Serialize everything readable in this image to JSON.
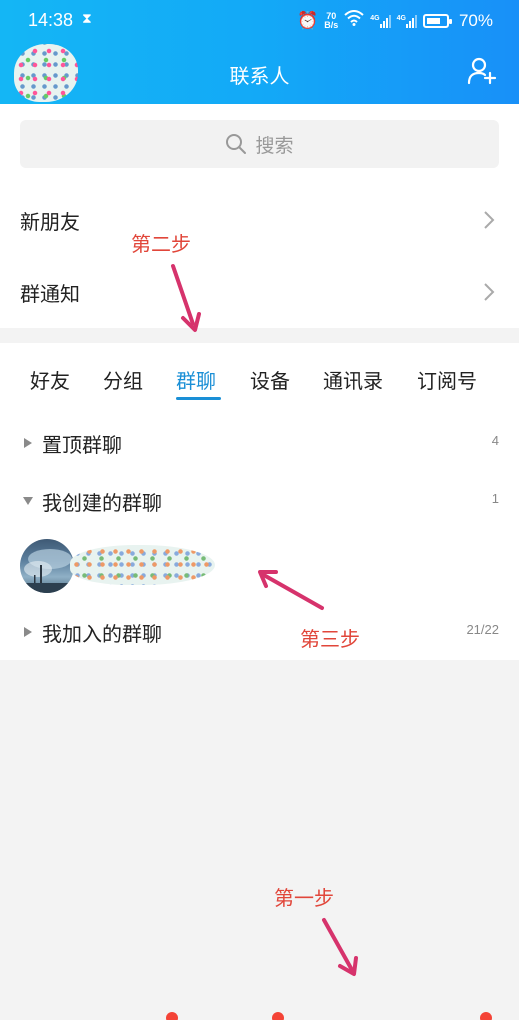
{
  "status_bar": {
    "time": "14:38",
    "net_speed_value": "70",
    "net_speed_unit": "B/s",
    "network_type_1": "4G",
    "network_type_2": "4G",
    "battery_level": 0.7,
    "battery_text": "70%"
  },
  "header": {
    "title": "联系人"
  },
  "search": {
    "placeholder": "搜索"
  },
  "menu": {
    "new_friends": "新朋友",
    "group_notice": "群通知"
  },
  "tabs": [
    {
      "label": "好友"
    },
    {
      "label": "分组"
    },
    {
      "label": "群聊",
      "active": true
    },
    {
      "label": "设备"
    },
    {
      "label": "通讯录"
    },
    {
      "label": "订阅号"
    }
  ],
  "groups": {
    "pinned": {
      "label": "置顶群聊",
      "count": "4"
    },
    "created": {
      "label": "我创建的群聊",
      "count": "1"
    },
    "joined": {
      "label": "我加入的群聊",
      "count": "21/22"
    }
  },
  "annotations": {
    "step1": "第一步",
    "step2": "第二步",
    "step3": "第三步"
  },
  "colors": {
    "header_gradient_start": "#14b6f5",
    "header_gradient_end": "#1890f8",
    "accent": "#1a8fd6",
    "annotation_text": "#e1463a",
    "annotation_arrow": "#d6336c"
  }
}
